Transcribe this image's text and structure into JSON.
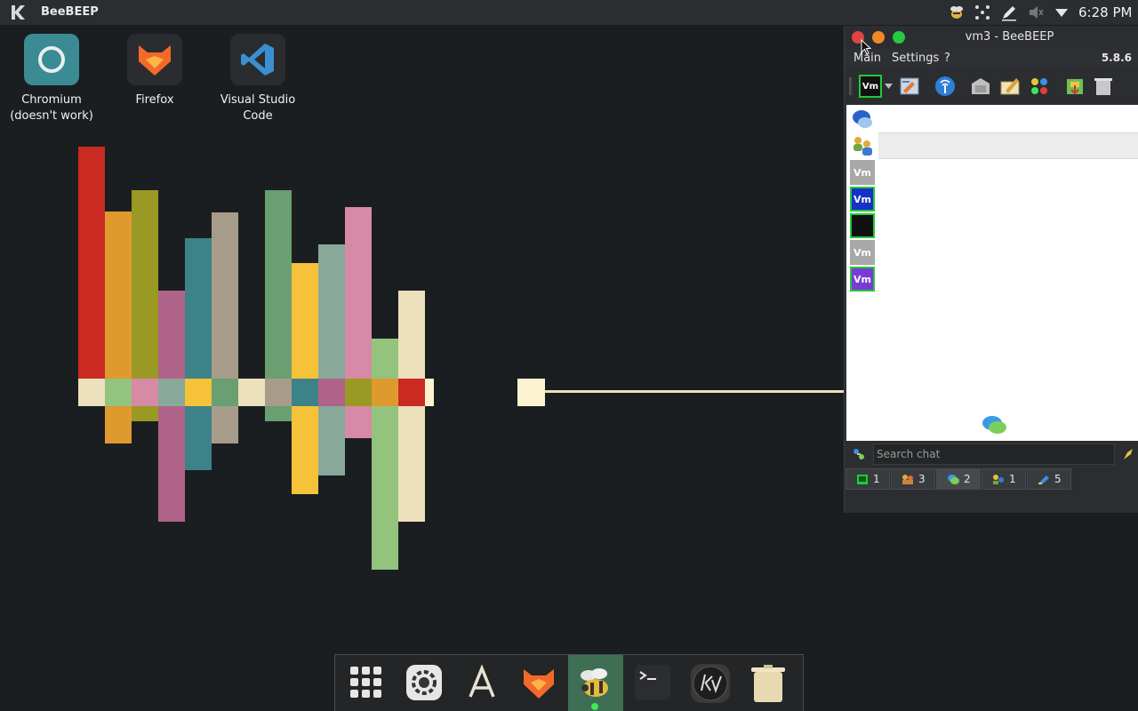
{
  "top_panel": {
    "app_name": "BeeBEEP",
    "clock": "6:28 PM",
    "tray_icons": [
      "beebeep-tray-icon",
      "network-icon",
      "pen-icon",
      "volume-muted-icon",
      "chevron-down-icon"
    ]
  },
  "desktop": {
    "icons": [
      {
        "name": "chromium",
        "label_line1": "Chromium",
        "label_line2": "(doesn't work)"
      },
      {
        "name": "firefox",
        "label_line1": "Firefox",
        "label_line2": ""
      },
      {
        "name": "vscode",
        "label_line1": "Visual Studio",
        "label_line2": "Code"
      }
    ]
  },
  "window": {
    "title": "vm3 - BeeBEEP",
    "menu": {
      "main": "Main",
      "settings": "Settings",
      "help": "?"
    },
    "version": "5.8.6",
    "toolbar_status_label": "Vm",
    "side_vm_label": "Vm",
    "search_placeholder": "Search chat",
    "tabs": [
      {
        "icon": "users-icon",
        "count": "1"
      },
      {
        "icon": "groups-icon",
        "count": "3"
      },
      {
        "icon": "chats-icon",
        "count": "2"
      },
      {
        "icon": "group-chat-icon",
        "count": "1"
      },
      {
        "icon": "share-icon",
        "count": "5"
      }
    ]
  },
  "dock": {
    "items": [
      "app-grid-icon",
      "settings-icon",
      "text-editor-icon",
      "firefox-icon",
      "beebeep-icon",
      "terminal-icon",
      "kv-icon",
      "trash-icon"
    ]
  },
  "colors": {
    "desktop_bg": "#1b1e20",
    "panel_bg": "#2b2e31",
    "close": "#e0443e",
    "minimize": "#f08a24",
    "maximize": "#27c93f",
    "dock_active": "#3e6f54"
  }
}
